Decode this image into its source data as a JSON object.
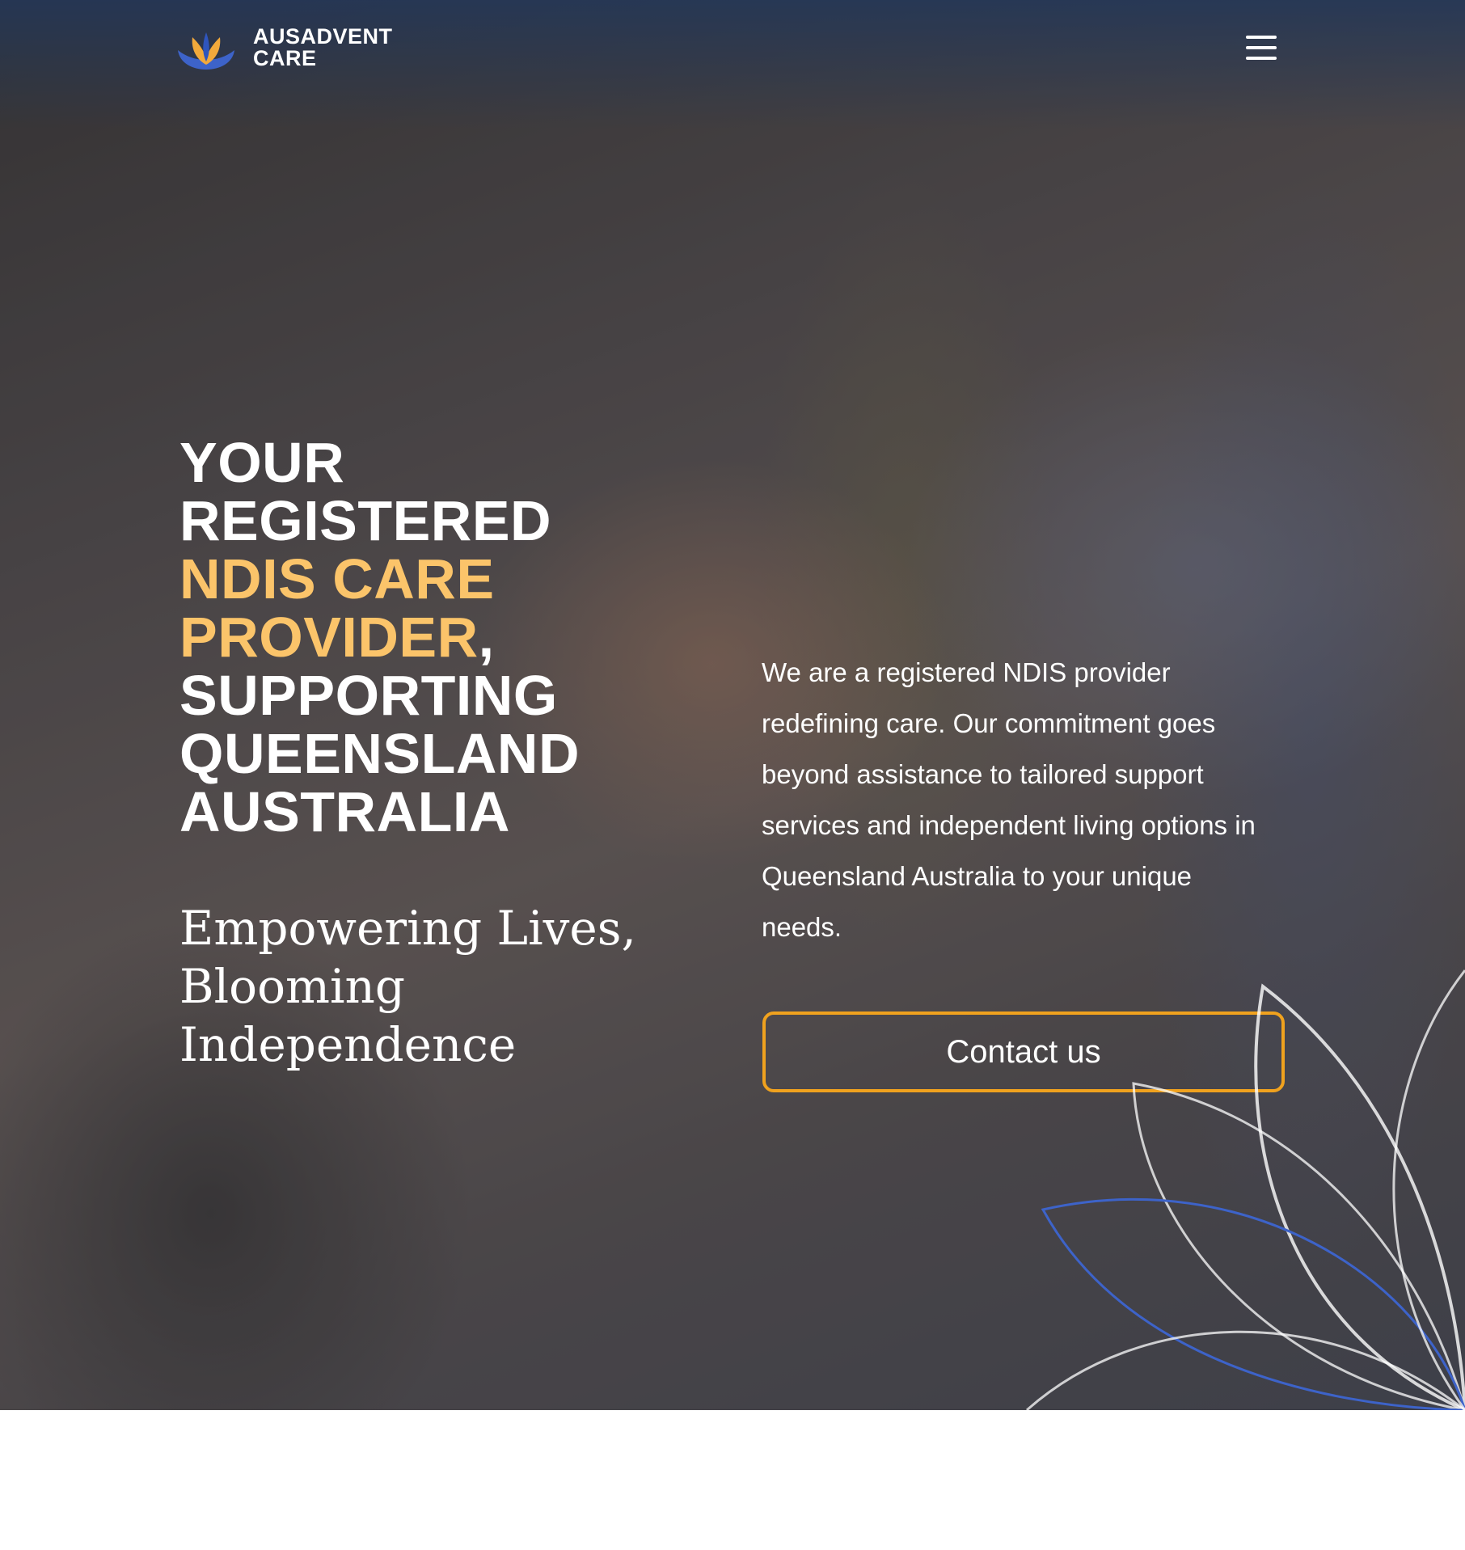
{
  "brand": {
    "name_line1": "AUSADVENT",
    "name_line2": "CARE",
    "logo_icon": "lotus-logo-icon",
    "colors": {
      "blue": "#3d63c9",
      "gold": "#f2a93b"
    }
  },
  "header": {
    "menu_icon": "hamburger-menu-icon"
  },
  "hero": {
    "headline": {
      "line1": "YOUR",
      "line2": "REGISTERED",
      "line3_accent": "NDIS CARE",
      "line4_accent": "PROVIDER",
      "line4_comma": ",",
      "line5": "SUPPORTING",
      "line6": "QUEENSLAND",
      "line7": "AUSTRALIA"
    },
    "tagline": {
      "line1": "Empowering Lives,",
      "line2": "Blooming",
      "line3": "Independence"
    },
    "intro": "We are a registered NDIS provider redefining care. Our commitment goes beyond assistance to tailored support services and independent living options in Queensland Australia to your unique needs.",
    "contact_label": "Contact us",
    "colors": {
      "accent": "#fbc46a",
      "button_border": "#f0a21e"
    }
  }
}
